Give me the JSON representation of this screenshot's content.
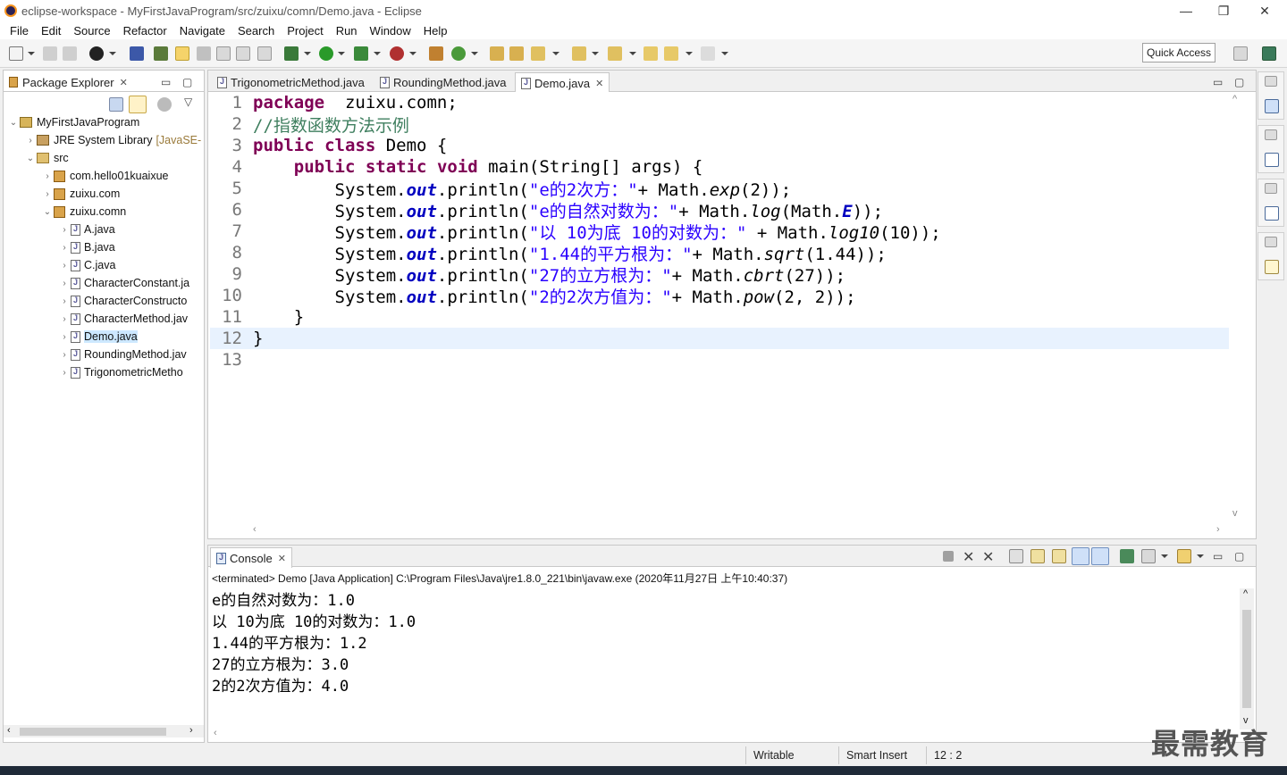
{
  "window": {
    "title": "eclipse-workspace - MyFirstJavaProgram/src/zuixu/comn/Demo.java - Eclipse",
    "minimize": "—",
    "restore": "❐",
    "close": "✕"
  },
  "menu": [
    "File",
    "Edit",
    "Source",
    "Refactor",
    "Navigate",
    "Search",
    "Project",
    "Run",
    "Window",
    "Help"
  ],
  "quick_access": "Quick Access",
  "explorer": {
    "tab_label": "Package Explorer",
    "tree": [
      {
        "label": "MyFirstJavaProgram",
        "kind": "project",
        "level": 0,
        "expanded": true
      },
      {
        "label": "JRE System Library",
        "suffix": "[JavaSE-",
        "kind": "library",
        "level": 1,
        "expanded": false
      },
      {
        "label": "src",
        "kind": "src",
        "level": 1,
        "expanded": true
      },
      {
        "label": "com.hello01kuaixue",
        "kind": "package",
        "level": 2,
        "expanded": false
      },
      {
        "label": "zuixu.com",
        "kind": "package",
        "level": 2,
        "expanded": false
      },
      {
        "label": "zuixu.comn",
        "kind": "package",
        "level": 2,
        "expanded": true
      },
      {
        "label": "A.java",
        "kind": "file",
        "level": 3
      },
      {
        "label": "B.java",
        "kind": "file",
        "level": 3
      },
      {
        "label": "C.java",
        "kind": "file",
        "level": 3
      },
      {
        "label": "CharacterConstant.ja",
        "kind": "file",
        "level": 3
      },
      {
        "label": "CharacterConstructo",
        "kind": "file",
        "level": 3
      },
      {
        "label": "CharacterMethod.jav",
        "kind": "file",
        "level": 3
      },
      {
        "label": "Demo.java",
        "kind": "file",
        "level": 3,
        "selected": true
      },
      {
        "label": "RoundingMethod.jav",
        "kind": "file",
        "level": 3
      },
      {
        "label": "TrigonometricMetho",
        "kind": "file",
        "level": 3
      }
    ]
  },
  "editor": {
    "tabs": [
      {
        "label": "TrigonometricMethod.java",
        "active": false
      },
      {
        "label": "RoundingMethod.java",
        "active": false
      },
      {
        "label": "Demo.java",
        "active": true
      }
    ],
    "lines": [
      {
        "n": "1",
        "parts": [
          [
            "kw",
            "package"
          ],
          [
            "",
            "  zuixu.comn;"
          ]
        ]
      },
      {
        "n": "2",
        "parts": [
          [
            "cm",
            "//指数函数方法示例"
          ]
        ]
      },
      {
        "n": "3",
        "parts": [
          [
            "kw",
            "public"
          ],
          [
            "",
            " "
          ],
          [
            "kw",
            "class"
          ],
          [
            "",
            " Demo {"
          ]
        ]
      },
      {
        "n": "4",
        "parts": [
          [
            "",
            "    "
          ],
          [
            "kw",
            "public"
          ],
          [
            "",
            " "
          ],
          [
            "kw",
            "static"
          ],
          [
            "",
            " "
          ],
          [
            "kw",
            "void"
          ],
          [
            "",
            " main(String[] args) {"
          ]
        ]
      },
      {
        "n": "5",
        "parts": [
          [
            "",
            "        System."
          ],
          [
            "fld",
            "out"
          ],
          [
            "",
            ".println("
          ],
          [
            "str",
            "\"e的2次方：\""
          ],
          [
            "",
            "+ Math."
          ],
          [
            "it",
            "exp"
          ],
          [
            "",
            "(2));"
          ]
        ]
      },
      {
        "n": "6",
        "parts": [
          [
            "",
            "        System."
          ],
          [
            "fld",
            "out"
          ],
          [
            "",
            ".println("
          ],
          [
            "str",
            "\"e的自然对数为：\""
          ],
          [
            "",
            "+ Math."
          ],
          [
            "it",
            "log"
          ],
          [
            "",
            "(Math."
          ],
          [
            "fld",
            "E"
          ],
          [
            "",
            "));"
          ]
        ]
      },
      {
        "n": "7",
        "parts": [
          [
            "",
            "        System."
          ],
          [
            "fld",
            "out"
          ],
          [
            "",
            ".println("
          ],
          [
            "str",
            "\"以 10为底 10的对数为：\""
          ],
          [
            "",
            " + Math."
          ],
          [
            "it",
            "log10"
          ],
          [
            "",
            "(10));"
          ]
        ]
      },
      {
        "n": "8",
        "parts": [
          [
            "",
            "        System."
          ],
          [
            "fld",
            "out"
          ],
          [
            "",
            ".println("
          ],
          [
            "str",
            "\"1.44的平方根为：\""
          ],
          [
            "",
            "+ Math."
          ],
          [
            "it",
            "sqrt"
          ],
          [
            "",
            "(1.44));"
          ]
        ]
      },
      {
        "n": "9",
        "parts": [
          [
            "",
            "        System."
          ],
          [
            "fld",
            "out"
          ],
          [
            "",
            ".println("
          ],
          [
            "str",
            "\"27的立方根为：\""
          ],
          [
            "",
            "+ Math."
          ],
          [
            "it",
            "cbrt"
          ],
          [
            "",
            "(27));"
          ]
        ]
      },
      {
        "n": "10",
        "parts": [
          [
            "",
            "        System."
          ],
          [
            "fld",
            "out"
          ],
          [
            "",
            ".println("
          ],
          [
            "str",
            "\"2的2次方值为：\""
          ],
          [
            "",
            "+ Math."
          ],
          [
            "it",
            "pow"
          ],
          [
            "",
            "(2, 2));"
          ]
        ]
      },
      {
        "n": "11",
        "parts": [
          [
            "",
            "    }"
          ]
        ]
      },
      {
        "n": "12",
        "parts": [
          [
            "",
            "}"
          ]
        ],
        "current": true
      },
      {
        "n": "13",
        "parts": [
          [
            "",
            ""
          ]
        ]
      }
    ]
  },
  "console": {
    "tab_label": "Console",
    "header": "<terminated> Demo [Java Application] C:\\Program Files\\Java\\jre1.8.0_221\\bin\\javaw.exe (2020年11月27日 上午10:40:37)",
    "output": [
      "e的自然对数为：1.0",
      "以 10为底 10的对数为：1.0",
      "1.44的平方根为：1.2",
      "27的立方根为：3.0",
      "2的2次方值为：4.0"
    ]
  },
  "status": {
    "writable": "Writable",
    "insert_mode": "Smart Insert",
    "position": "12 : 2"
  },
  "watermark": "最需教育",
  "colors": {
    "keyword": "#7f0055",
    "comment": "#3f7f5f",
    "string": "#2a00ff",
    "field": "#0000c0",
    "selection": "#cde8ff",
    "current_line": "#e8f2fe"
  }
}
